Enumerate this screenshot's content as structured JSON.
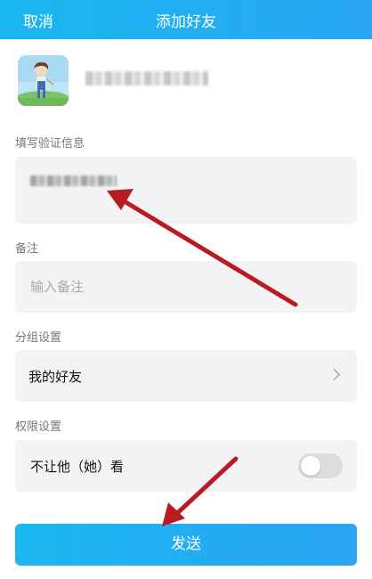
{
  "header": {
    "cancel_label": "取消",
    "title": "添加好友"
  },
  "profile": {
    "avatar": "cartoon-boy-avatar",
    "nickname": "blurred"
  },
  "verify": {
    "label": "填写验证信息",
    "value": "blurred"
  },
  "remark": {
    "label": "备注",
    "placeholder": "输入备注",
    "value": ""
  },
  "group": {
    "label": "分组设置",
    "value": "我的好友"
  },
  "permission": {
    "label": "权限设置",
    "option_label": "不让他（她）看",
    "enabled": false
  },
  "send_label": "发送",
  "colors": {
    "header": "#1ab7f0",
    "button": "#2aa6f4",
    "annotation_arrow": "#b81c22"
  }
}
